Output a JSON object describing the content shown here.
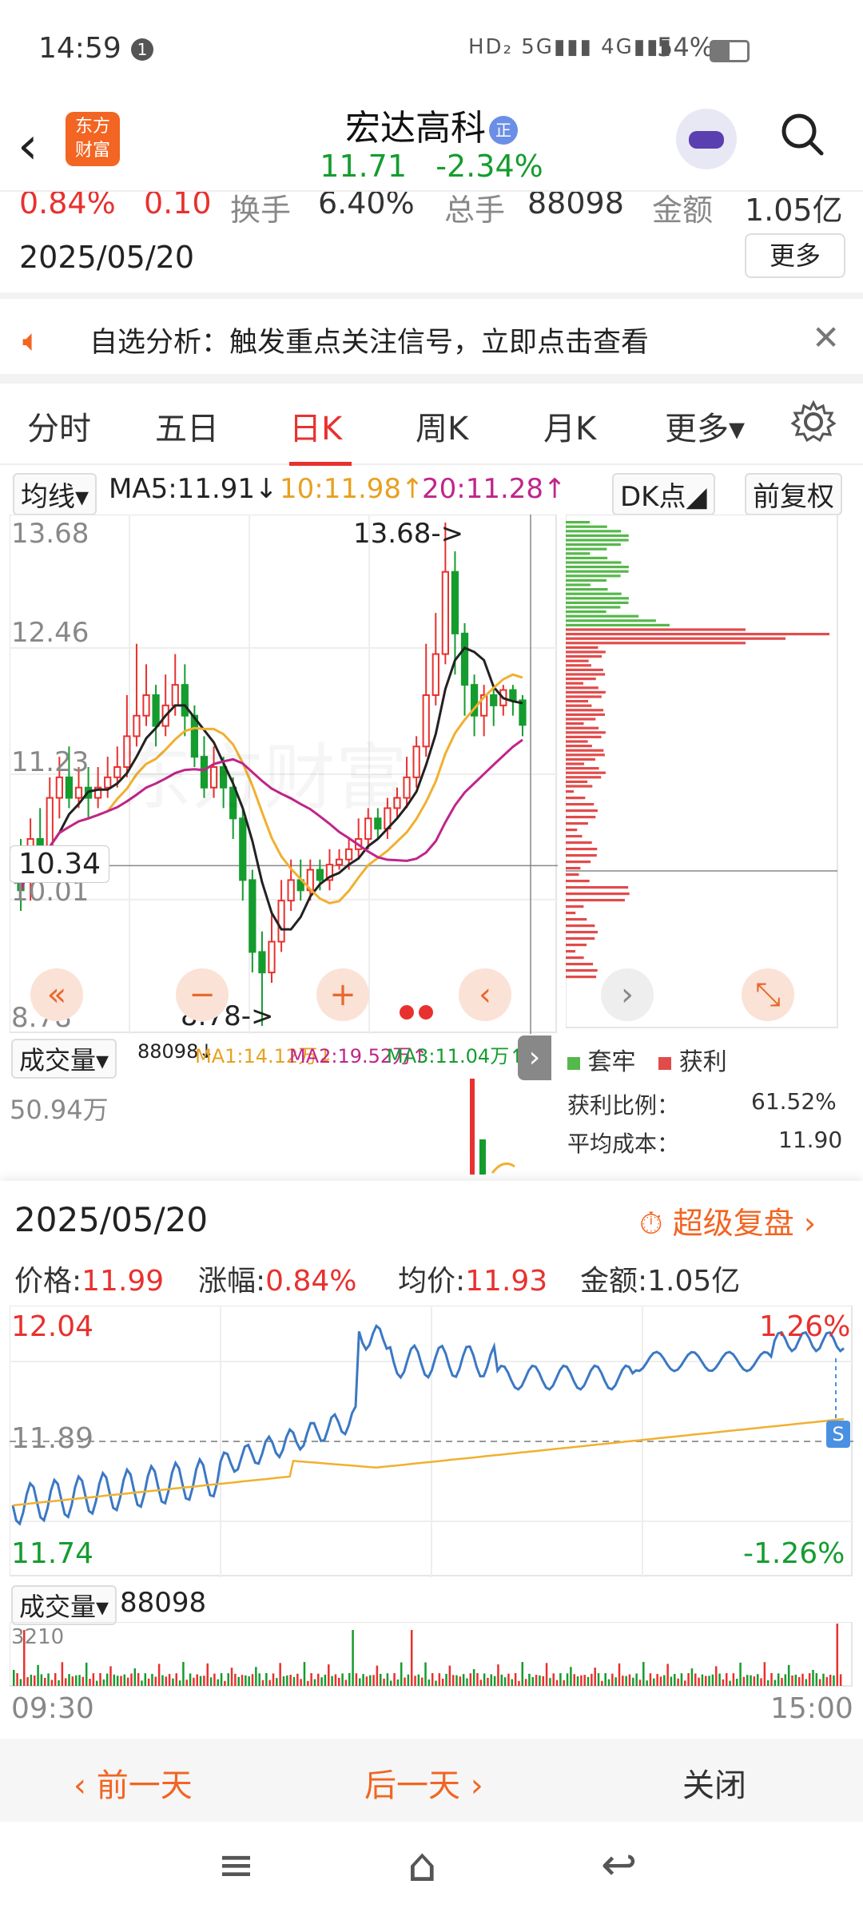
{
  "status_bar": {
    "time": "14:59",
    "notif": "1",
    "signal": "HD₂ 5G▮▮▮ 4G▮▮▮ ",
    "battery": "54%"
  },
  "header": {
    "logo_text_1": "东方",
    "logo_text_2": "财富",
    "stock_name": "宏达高科",
    "badge": "正",
    "price": "11.71",
    "change_pct": "-2.34%"
  },
  "quote_strip": {
    "pct": "0.84%",
    "chg": "0.10",
    "turnover_label": "换手",
    "turnover": "6.40%",
    "vol_label": "总手",
    "vol": "88098",
    "amount_label": "金额",
    "amount": "1.05亿",
    "date": "2025/05/20",
    "more": "更多"
  },
  "notice": {
    "text": "自选分析：触发重点关注信号，立即点击查看"
  },
  "tabs": {
    "items": [
      "分时",
      "五日",
      "日K",
      "周K",
      "月K",
      "更多▾"
    ],
    "active": "日K"
  },
  "ma_row": {
    "ma_btn": "均线▾",
    "ma5": "MA5:11.91↓",
    "ma10": "10:11.98↑",
    "ma20": "20:11.28↑",
    "dk_btn": "DK点◢",
    "fq_btn": "前复权"
  },
  "kline": {
    "y_labels": [
      "13.68",
      "12.46",
      "11.23",
      "10.01",
      "8.78"
    ],
    "current_label": "10.34",
    "high_mark": "13.68->",
    "low_mark": "8.78->",
    "colors": {
      "up": "#e8312f",
      "down": "#159c2f",
      "ma5": "#222222",
      "ma10": "#f0b030",
      "ma20": "#c0258a"
    },
    "controls": [
      "«",
      "−",
      "+",
      "‹",
      "›",
      "⤡"
    ],
    "watermark": "东方财富"
  },
  "chips": {
    "legend_trap": "套牢",
    "legend_profit": "获利",
    "profit_ratio_label": "获利比例：",
    "profit_ratio": "61.52%",
    "avg_cost_label": "平均成本：",
    "avg_cost": "11.90"
  },
  "volume_row": {
    "btn": "成交量▾",
    "v": "88098↓",
    "ma1": "MA1:14.12万↓",
    "ma2": "MA2:19.52万↑",
    "ma3": "MA3:11.04万↑",
    "max_label": "50.94万"
  },
  "popup": {
    "date": "2025/05/20",
    "fupan": "超级复盘",
    "price_label": "价格:",
    "price": "11.99",
    "pct_label": "涨幅:",
    "pct": "0.84%",
    "avg_label": "均价:",
    "avg": "11.93",
    "amt_label": "金额:",
    "amt": "1.05亿",
    "y_top": "12.04",
    "y_mid": "11.89",
    "y_bot": "11.74",
    "pct_top": "1.26%",
    "pct_bot": "-1.26%",
    "vol_btn": "成交量▾",
    "vol_val": "88098",
    "vol_max": "3210",
    "t_start": "09:30",
    "t_end": "15:00",
    "s_marker": "S"
  },
  "footer": {
    "prev": "‹ 前一天",
    "next": "后一天 ›",
    "close": "关闭"
  },
  "navbar": {
    "menu": "≡",
    "home": "⌂",
    "back": "↩"
  }
}
